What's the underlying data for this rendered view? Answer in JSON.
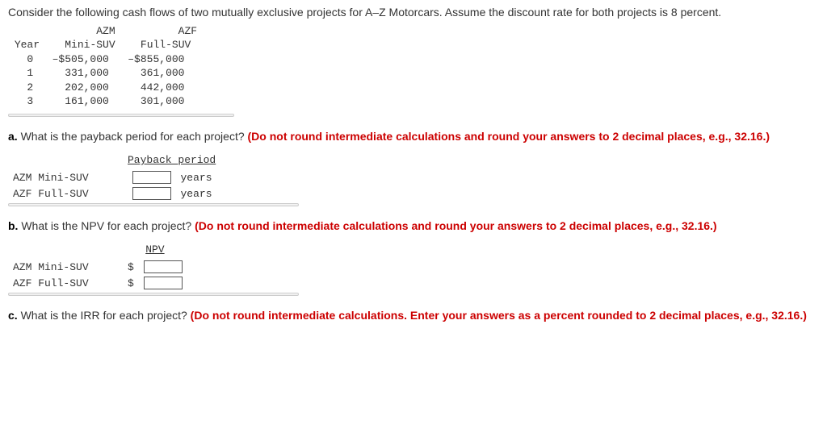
{
  "intro": "Consider the following cash flows of two mutually exclusive projects for A–Z Motorcars. Assume the discount rate for both projects is 8 percent.",
  "cashflow_table": {
    "headers": {
      "year": "Year",
      "h1a": "AZM",
      "h1b": "Mini-SUV",
      "h2a": "AZF",
      "h2b": "Full-SUV"
    },
    "rows": [
      {
        "year": "0",
        "azm": "–$505,000",
        "azf": "–$855,000"
      },
      {
        "year": "1",
        "azm": "331,000",
        "azf": "361,000"
      },
      {
        "year": "2",
        "azm": "202,000",
        "azf": "442,000"
      },
      {
        "year": "3",
        "azm": "161,000",
        "azf": "301,000"
      }
    ]
  },
  "qa": {
    "label": "a.",
    "prompt": "What is the payback period for each project?",
    "note": "(Do not round intermediate calculations and round your answers to 2 decimal places, e.g., 32.16.)",
    "header": "Payback period",
    "rows": [
      {
        "label": "AZM Mini-SUV",
        "unit": "years"
      },
      {
        "label": "AZF Full-SUV",
        "unit": "years"
      }
    ]
  },
  "qb": {
    "label": "b.",
    "prompt": "What is the NPV for each project?",
    "note": "(Do not round intermediate calculations and round your answers to 2 decimal places, e.g., 32.16.)",
    "header": "NPV",
    "rows": [
      {
        "label": "AZM Mini-SUV",
        "prefix": "$"
      },
      {
        "label": "AZF Full-SUV",
        "prefix": "$"
      }
    ]
  },
  "qc": {
    "label": "c.",
    "prompt": "What is the IRR for each project?",
    "note": "(Do not round intermediate calculations. Enter your answers as a percent rounded to 2 decimal places, e.g., 32.16.)"
  },
  "chart_data": {
    "type": "table",
    "title": "Project cash flows (A–Z Motorcars)",
    "discount_rate_pct": 8,
    "columns": [
      "Year",
      "AZM Mini-SUV",
      "AZF Full-SUV"
    ],
    "rows": [
      [
        0,
        -505000,
        -855000
      ],
      [
        1,
        331000,
        361000
      ],
      [
        2,
        202000,
        442000
      ],
      [
        3,
        161000,
        301000
      ]
    ]
  }
}
